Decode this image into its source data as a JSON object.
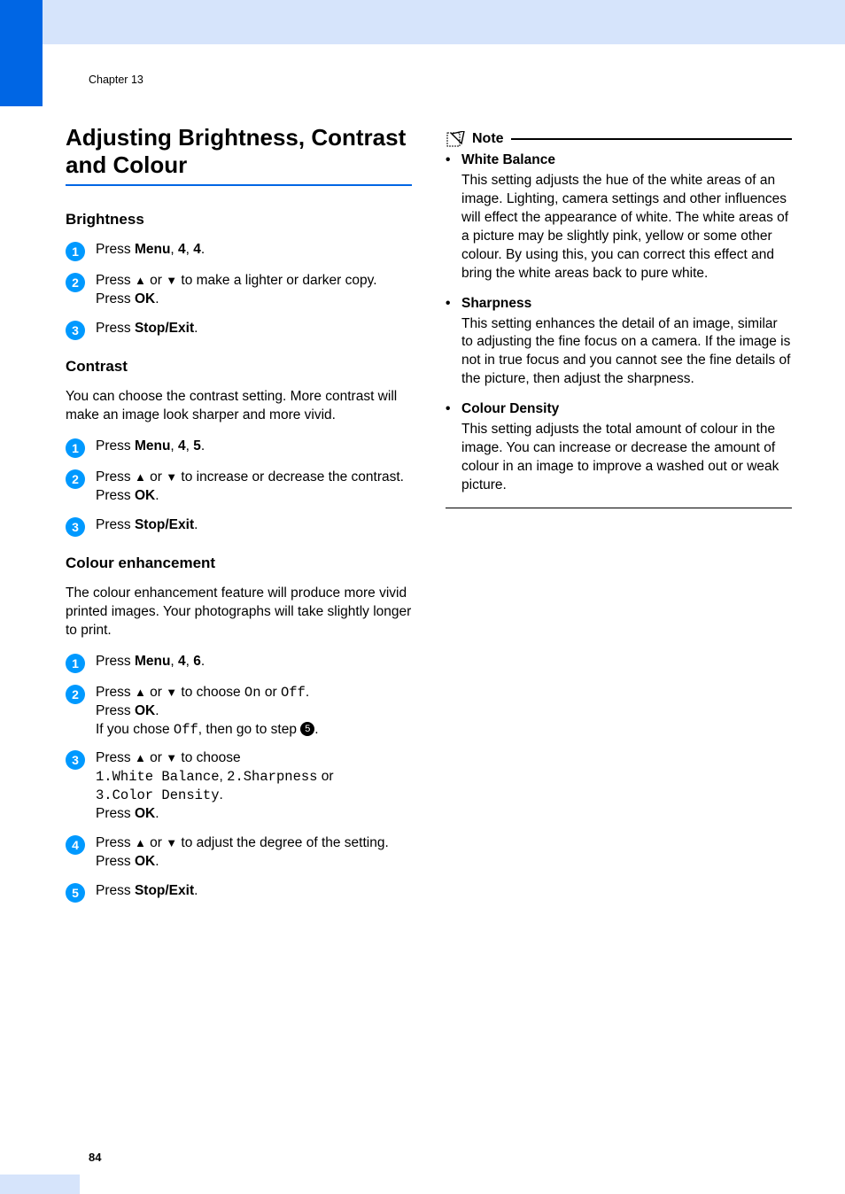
{
  "meta": {
    "chapter_label": "Chapter 13",
    "page_number": "84"
  },
  "title": "Adjusting Brightness, Contrast and Colour",
  "brightness": {
    "heading": "Brightness",
    "steps": {
      "s1_a": "Press ",
      "s1_menu": "Menu",
      "s1_b": ", ",
      "s1_k1": "4",
      "s1_c": ", ",
      "s1_k2": "4",
      "s1_d": ".",
      "s2_a": "Press ",
      "s2_or": " or ",
      "s2_b": " to make a lighter or darker copy.",
      "s2_press": "Press ",
      "s2_ok": "OK",
      "s2_dot": ".",
      "s3_a": "Press ",
      "s3_stop": "Stop/Exit",
      "s3_dot": "."
    }
  },
  "contrast": {
    "heading": "Contrast",
    "intro": "You can choose the contrast setting. More contrast will make an image look sharper and more vivid.",
    "steps": {
      "s1_a": "Press ",
      "s1_menu": "Menu",
      "s1_b": ", ",
      "s1_k1": "4",
      "s1_c": ", ",
      "s1_k2": "5",
      "s1_d": ".",
      "s2_a": "Press ",
      "s2_or": " or ",
      "s2_b": " to increase or decrease the contrast.",
      "s2_press": "Press ",
      "s2_ok": "OK",
      "s2_dot": ".",
      "s3_a": "Press ",
      "s3_stop": "Stop/Exit",
      "s3_dot": "."
    }
  },
  "colour": {
    "heading": "Colour enhancement",
    "intro": "The colour enhancement feature will produce more vivid printed images. Your photographs will take slightly longer to print.",
    "steps": {
      "s1_a": "Press ",
      "s1_menu": "Menu",
      "s1_b": ", ",
      "s1_k1": "4",
      "s1_c": ", ",
      "s1_k2": "6",
      "s1_d": ".",
      "s2_a": "Press ",
      "s2_or": " or ",
      "s2_b": " to choose ",
      "s2_on": "On",
      "s2_or2": " or ",
      "s2_off": "Off",
      "s2_dot1": ".",
      "s2_press": "Press ",
      "s2_ok": "OK",
      "s2_dot2": ".",
      "s2_if_a": "If you chose ",
      "s2_if_off": "Off",
      "s2_if_b": ", then go to step ",
      "s2_if_num": "5",
      "s2_if_c": ".",
      "s3_a": "Press ",
      "s3_or": " or ",
      "s3_b": " to choose ",
      "s3_opt1": "1.White Balance",
      "s3_c": ", ",
      "s3_opt2": "2.Sharpness",
      "s3_d": " or ",
      "s3_opt3": "3.Color Density",
      "s3_e": ".",
      "s3_press": "Press ",
      "s3_ok": "OK",
      "s3_dot": ".",
      "s4_a": "Press ",
      "s4_or": " or ",
      "s4_b": " to adjust the degree of the setting.",
      "s4_press": "Press ",
      "s4_ok": "OK",
      "s4_dot": ".",
      "s5_a": "Press ",
      "s5_stop": "Stop/Exit",
      "s5_dot": "."
    }
  },
  "note": {
    "title": "Note",
    "items": [
      {
        "title": "White Balance",
        "desc": "This setting adjusts the hue of the white areas of an image. Lighting, camera settings and other influences will effect the appearance of white. The white areas of a picture may be slightly pink, yellow or some other colour. By using this, you can correct this effect and bring the white areas back to pure white."
      },
      {
        "title": "Sharpness",
        "desc": "This setting enhances the detail of an image, similar to adjusting the fine focus on a camera. If the image is not in true focus and you cannot see the fine details of the picture, then adjust the sharpness."
      },
      {
        "title": "Colour Density",
        "desc": "This setting adjusts the total amount of colour in the image. You can increase or decrease the amount of colour in an image to improve a washed out or weak picture."
      }
    ]
  },
  "glyphs": {
    "up": "▲",
    "down": "▼",
    "bullet": "•"
  },
  "nums": {
    "n1": "1",
    "n2": "2",
    "n3": "3",
    "n4": "4",
    "n5": "5"
  }
}
